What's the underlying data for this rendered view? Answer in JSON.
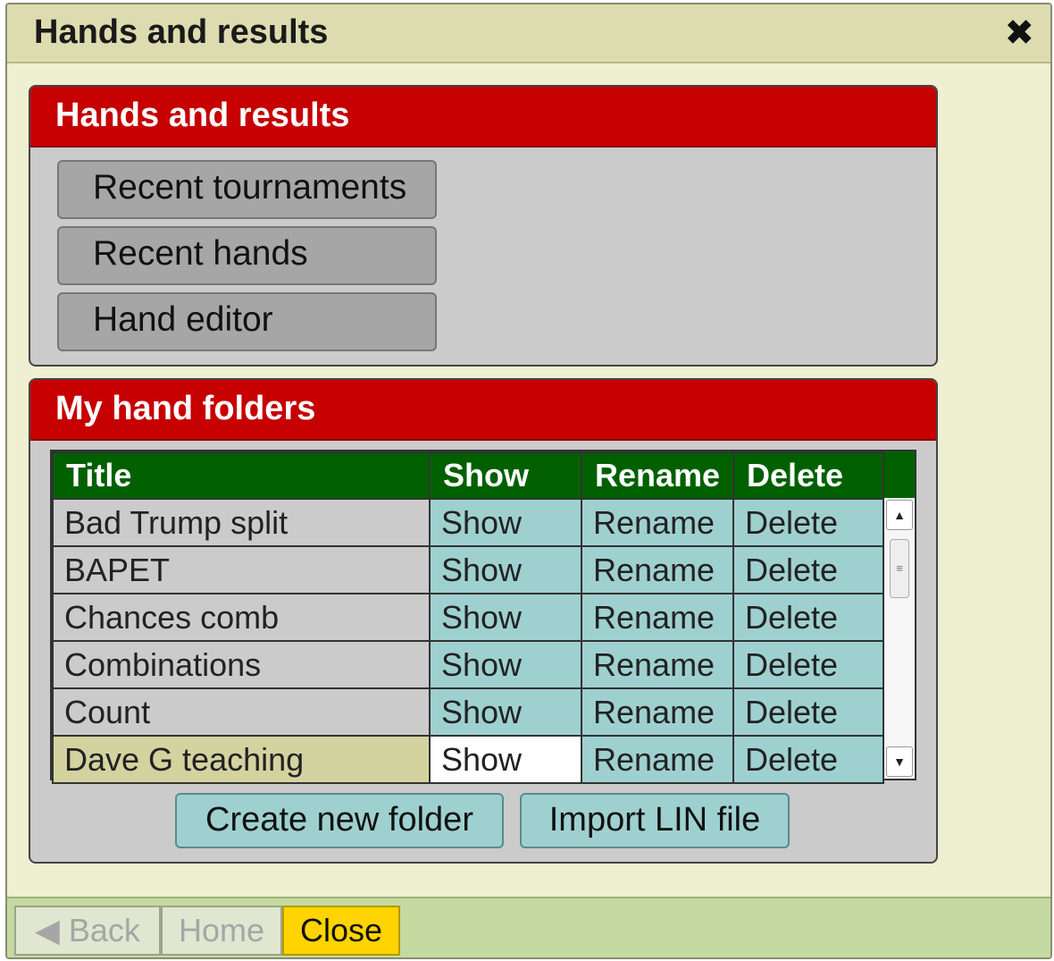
{
  "window": {
    "title": "Hands and results",
    "close_icon": "close-icon"
  },
  "panel_top": {
    "header": "Hands and results",
    "buttons": [
      "Recent tournaments",
      "Recent hands",
      "Hand editor"
    ]
  },
  "panel_bottom": {
    "header": "My hand folders",
    "table": {
      "columns": [
        "Title",
        "Show",
        "Rename",
        "Delete"
      ],
      "rows": [
        {
          "title": "Bad Trump split",
          "show": "Show",
          "rename": "Rename",
          "delete": "Delete"
        },
        {
          "title": "BAPET",
          "show": "Show",
          "rename": "Rename",
          "delete": "Delete"
        },
        {
          "title": "Chances comb",
          "show": "Show",
          "rename": "Rename",
          "delete": "Delete"
        },
        {
          "title": "Combinations",
          "show": "Show",
          "rename": "Rename",
          "delete": "Delete"
        },
        {
          "title": "Count",
          "show": "Show",
          "rename": "Rename",
          "delete": "Delete"
        },
        {
          "title": "Dave G teaching",
          "show": "Show",
          "rename": "Rename",
          "delete": "Delete"
        }
      ]
    },
    "create_button": "Create new folder",
    "import_button": "Import LIN file"
  },
  "footer": {
    "back_label": "◀ Back",
    "home_label": "Home",
    "close_label": "Close"
  },
  "colors": {
    "window_bg": "#efefd1",
    "header_red": "#c60000",
    "table_header_green": "#006000",
    "action_teal": "#9fd0d0",
    "selected_row": "#d3d3a0",
    "close_yellow": "#ffd400"
  }
}
